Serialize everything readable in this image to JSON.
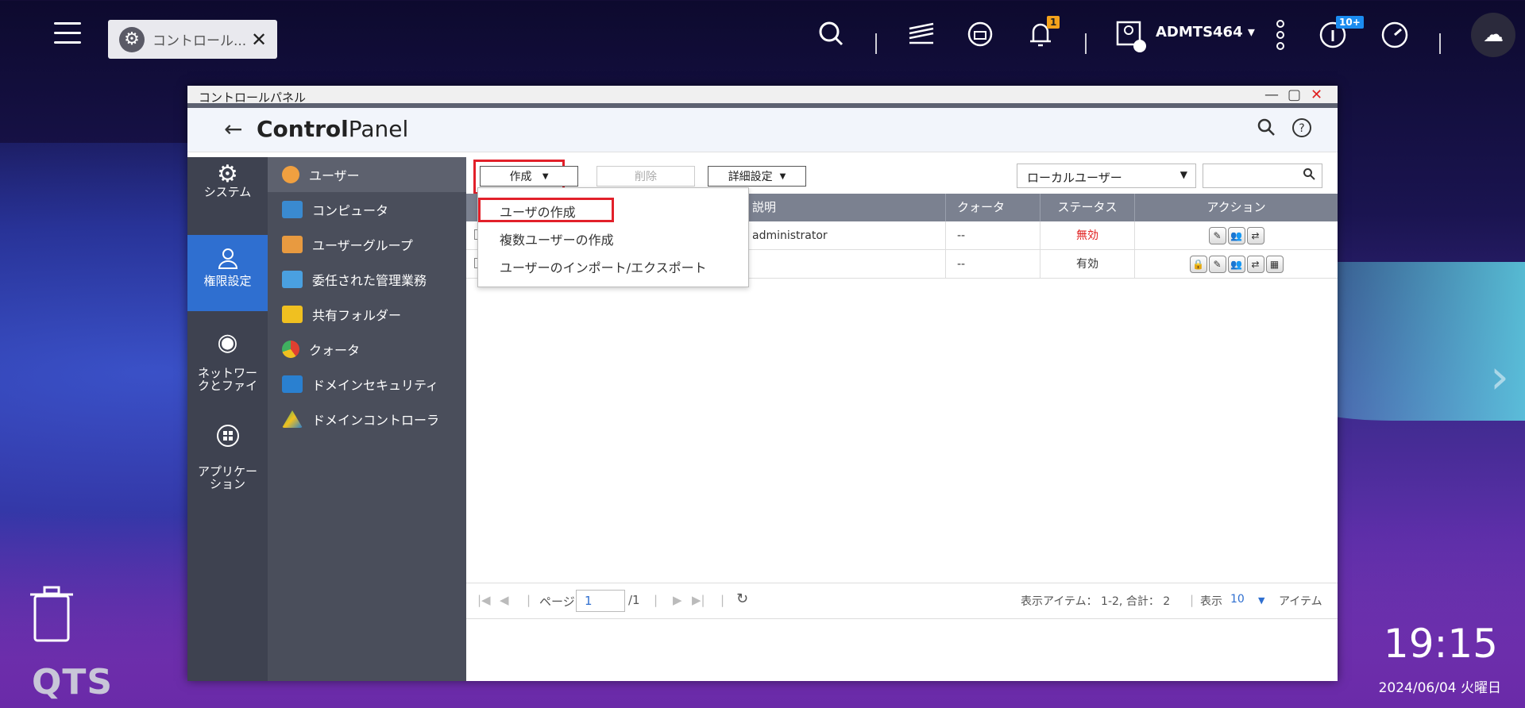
{
  "taskbar": {
    "tab_label": "コントロール...",
    "notification_count": "1",
    "updates_count": "10+",
    "username": "ADMTS464"
  },
  "window": {
    "title": "コントロールパネル",
    "header_bold": "Control",
    "header_rest": "Panel"
  },
  "left_nav": [
    {
      "label": "システム",
      "icon": "gear-icon"
    },
    {
      "label": "権限設定",
      "icon": "user-icon"
    },
    {
      "label": "ネットワー\nクとファイ",
      "icon": "globe-icon"
    },
    {
      "label": "アプリケー\nション",
      "icon": "grid-icon"
    }
  ],
  "sub_nav": [
    {
      "label": "ユーザー",
      "color": "#f0a040"
    },
    {
      "label": "コンピュータ",
      "color": "#3a8ad0"
    },
    {
      "label": "ユーザーグループ",
      "color": "#e89a40"
    },
    {
      "label": "委任された管理業務",
      "color": "#4aa0e0"
    },
    {
      "label": "共有フォルダー",
      "color": "#f0c020"
    },
    {
      "label": "クォータ",
      "color": "#e04030"
    },
    {
      "label": "ドメインセキュリティ",
      "color": "#2a80d0"
    },
    {
      "label": "ドメインコントローラ",
      "color": "#40b060"
    }
  ],
  "toolbar": {
    "create": "作成",
    "delete": "削除",
    "advanced": "詳細設定",
    "user_type": "ローカルユーザー"
  },
  "dropdown": {
    "items": [
      "ユーザの作成",
      "複数ユーザーの作成",
      "ユーザーのインポート/エクスポート"
    ]
  },
  "table": {
    "headers": {
      "description": "説明",
      "quota": "クォータ",
      "status": "ステータス",
      "action": "アクション"
    },
    "rows": [
      {
        "description": "administrator",
        "quota": "--",
        "status": "無効",
        "status_color": "#e02020"
      },
      {
        "description": "",
        "quota": "--",
        "status": "有効",
        "status_color": "#333333"
      }
    ]
  },
  "pager": {
    "page_label": "ページ",
    "page": "1",
    "total_pages": "/1",
    "items_info": "表示アイテム： 1-2, 合計： 2",
    "show_label": "表示",
    "per_page": "10",
    "items_label": "アイテム"
  },
  "desktop": {
    "brand": "QTS",
    "time": "19:15",
    "date": "2024/06/04 火曜日"
  }
}
